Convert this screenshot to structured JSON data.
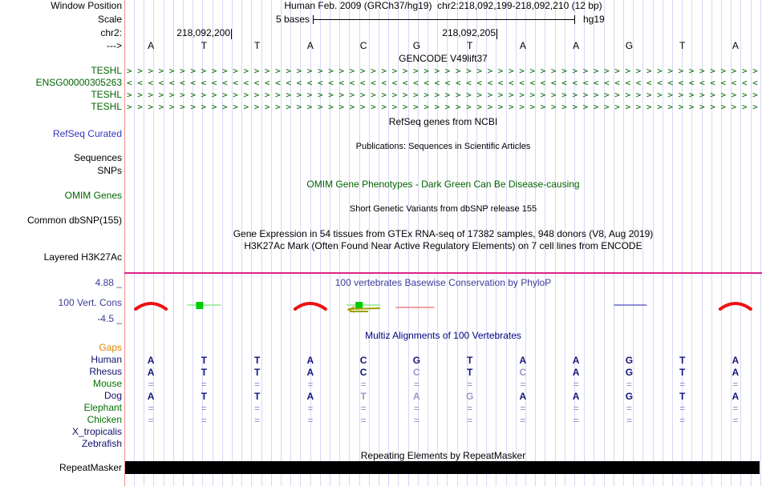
{
  "header": {
    "window_position_label": "Window Position",
    "assembly_line": "Human Feb. 2009 (GRCh37/hg19)",
    "position_line": "chr2:218,092,199-218,092,210 (12 bp)",
    "scale_label": "Scale",
    "scale_value": "5 bases",
    "assembly_tag": "hg19",
    "chrom_label": "chr2:",
    "strand_arrow": "--->",
    "ruler_ticks": [
      "218,092,200",
      "218,092,205"
    ]
  },
  "sequence": {
    "bases": [
      "A",
      "T",
      "T",
      "A",
      "C",
      "G",
      "T",
      "A",
      "A",
      "G",
      "T",
      "A"
    ]
  },
  "gencode": {
    "title": "GENCODE V49lift37",
    "genes": [
      {
        "label": "TESHL",
        "direction": "forward"
      },
      {
        "label": "ENSG00000305263",
        "direction": "reverse"
      },
      {
        "label": "TESHL",
        "direction": "forward"
      },
      {
        "label": "TESHL",
        "direction": "forward"
      }
    ]
  },
  "refseq": {
    "title": "RefSeq genes from NCBI",
    "label": "RefSeq Curated"
  },
  "publications": {
    "title": "Publications: Sequences in Scientific Articles"
  },
  "sequences_label": "Sequences",
  "snps_label": "SNPs",
  "omim": {
    "title": "OMIM Gene Phenotypes - Dark Green Can Be Disease-causing",
    "label": "OMIM Genes"
  },
  "dbsnp": {
    "title": "Short Genetic Variants from dbSNP release 155",
    "label": "Common dbSNP(155)"
  },
  "gtex": {
    "title": "Gene Expression in 54 tissues from GTEx RNA-seq of 17382 samples, 948 donors (V8, Aug 2019)"
  },
  "h3k27ac": {
    "title": "H3K27Ac Mark (Often Found Near Active Regulatory Elements) on 7 cell lines from ENCODE",
    "label": "Layered H3K27Ac"
  },
  "conservation": {
    "title": "100 vertebrates Basewise Conservation by PhyloP",
    "label": "100 Vert. Cons",
    "scale_max": "4.88 _",
    "scale_min": "-4.5 _",
    "glyphs": [
      {
        "base": 1,
        "kind": "red-arch"
      },
      {
        "base": 2,
        "kind": "green-line-box"
      },
      {
        "base": 4,
        "kind": "red-arch"
      },
      {
        "base": 5,
        "kind": "green-line-box-olive"
      },
      {
        "base": 6,
        "kind": "salmon-line"
      },
      {
        "base": 10,
        "kind": "blue-line"
      },
      {
        "base": 12,
        "kind": "red-arch"
      }
    ],
    "colors": {
      "arch": "#ee1111",
      "line_green": "#8ee88e",
      "box_green": "#00cc00",
      "olive": "#a0a000",
      "salmon": "#f08080",
      "blue": "#6a6acc"
    }
  },
  "multiz": {
    "title": "Multiz Alignments of 100 Vertebrates",
    "rows": [
      {
        "name": "Gaps",
        "label_color": "orange",
        "cells": [],
        "dim": []
      },
      {
        "name": "Human",
        "label_color": "navy",
        "cells": [
          "A",
          "T",
          "T",
          "A",
          "C",
          "G",
          "T",
          "A",
          "A",
          "G",
          "T",
          "A"
        ],
        "dim": []
      },
      {
        "name": "Rhesus",
        "label_color": "navy",
        "cells": [
          "A",
          "T",
          "T",
          "A",
          "C",
          "C",
          "T",
          "C",
          "A",
          "G",
          "T",
          "A"
        ],
        "dim": [
          5,
          7
        ]
      },
      {
        "name": "Mouse",
        "label_color": "green",
        "cells": [
          "=",
          "=",
          "=",
          "=",
          "=",
          "=",
          "=",
          "=",
          "=",
          "=",
          "=",
          "="
        ],
        "dim": []
      },
      {
        "name": "Dog",
        "label_color": "navy",
        "cells": [
          "A",
          "T",
          "T",
          "A",
          "T",
          "A",
          "G",
          "A",
          "A",
          "G",
          "T",
          "A"
        ],
        "dim": [
          4,
          5,
          6
        ]
      },
      {
        "name": "Elephant",
        "label_color": "green",
        "cells": [
          "=",
          "=",
          "=",
          "=",
          "=",
          "=",
          "=",
          "=",
          "=",
          "=",
          "=",
          "="
        ],
        "dim": []
      },
      {
        "name": "Chicken",
        "label_color": "green",
        "cells": [
          "=",
          "=",
          "=",
          "=",
          "=",
          "=",
          "=",
          "=",
          "=",
          "=",
          "=",
          "="
        ],
        "dim": []
      },
      {
        "name": "X_tropicalis",
        "label_color": "navy",
        "cells": [],
        "dim": []
      },
      {
        "name": "Zebrafish",
        "label_color": "navy",
        "cells": [],
        "dim": []
      }
    ]
  },
  "repeatmasker": {
    "title": "Repeating Elements by RepeatMasker",
    "label": "RepeatMasker"
  }
}
